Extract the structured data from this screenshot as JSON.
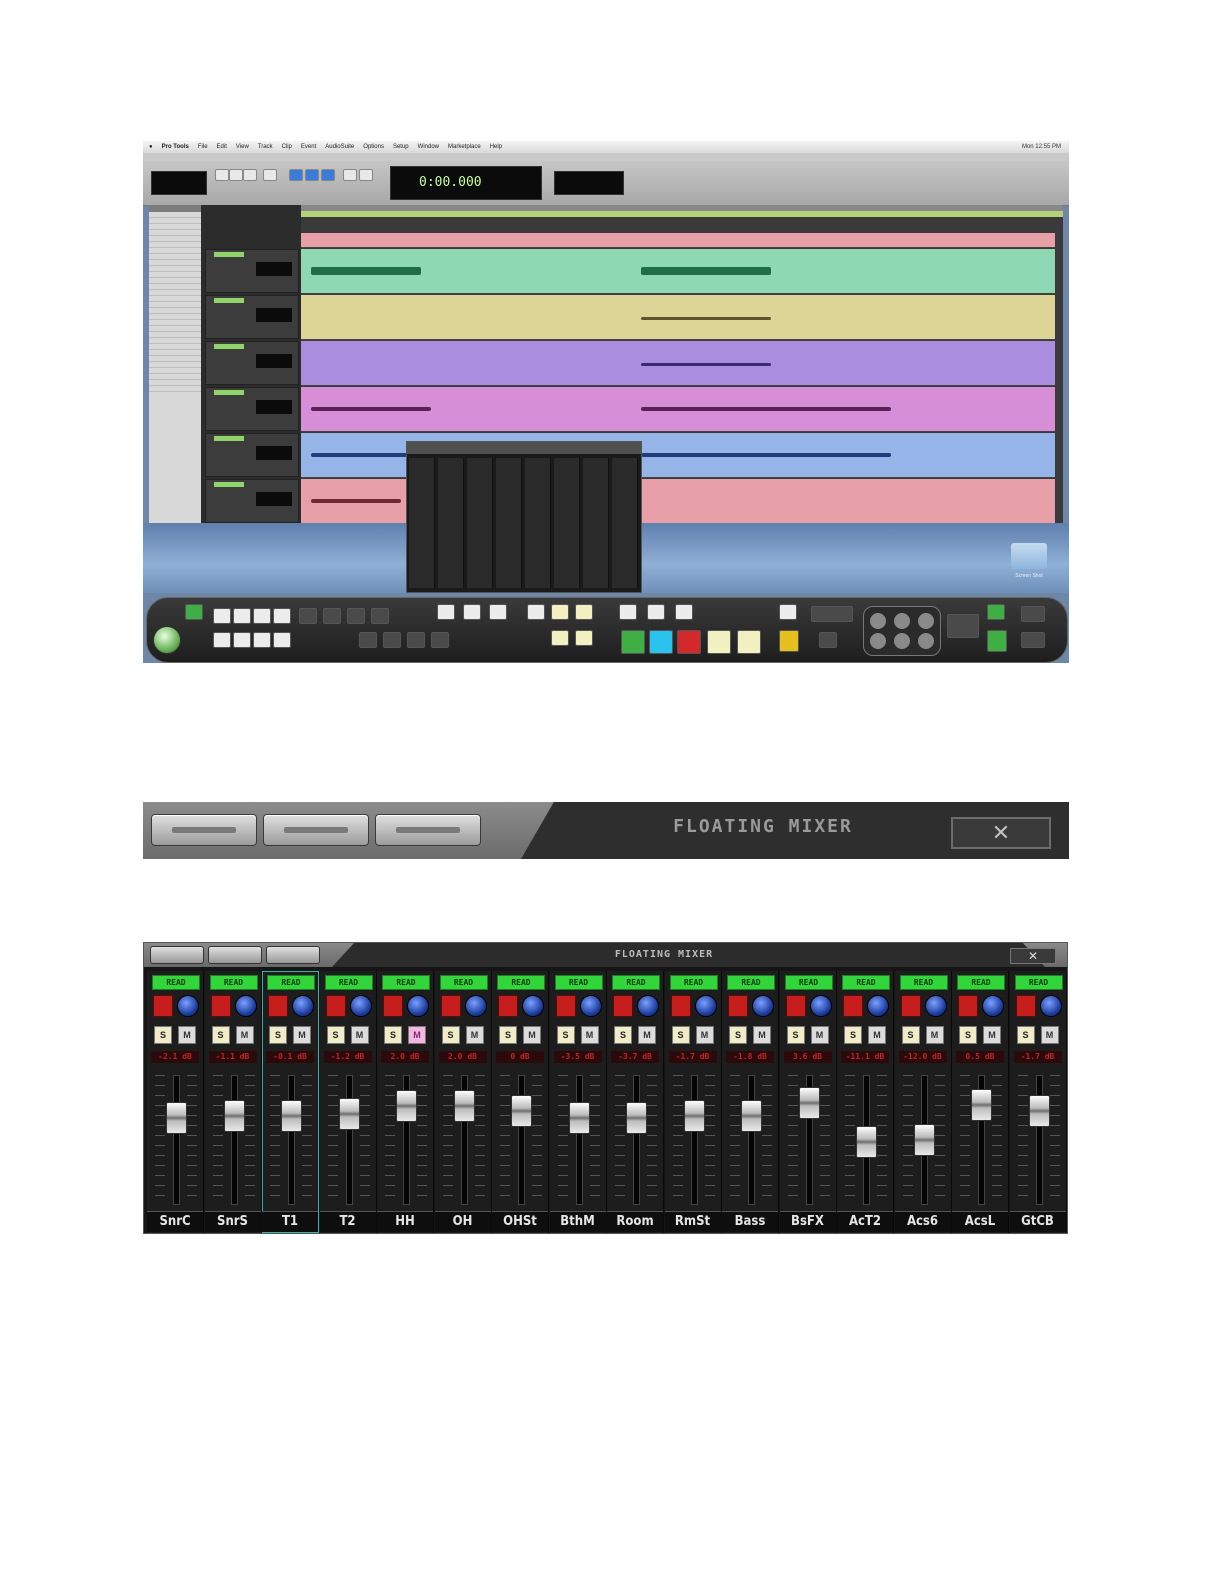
{
  "protools": {
    "app_name": "Pro Tools",
    "menus": [
      "File",
      "Edit",
      "View",
      "Track",
      "Clip",
      "Event",
      "AudioSuite",
      "Options",
      "Setup",
      "Window",
      "Marketplace",
      "Help"
    ],
    "clock": "Mon 12:55 PM",
    "counter": "0:00.000",
    "desktop_folder_label": "Screen Shot"
  },
  "floating_mixer_header": {
    "title": "FLOATING MIXER",
    "close": "✕"
  },
  "floating_mixer": {
    "title": "FLOATING MIXER",
    "close": "✕",
    "channels": [
      {
        "name": "SnrC",
        "auto": "READ",
        "vol": "-2.1 dB",
        "fader": 0.72,
        "mute_on": false,
        "selected": false
      },
      {
        "name": "SnrS",
        "auto": "READ",
        "vol": "-1.1 dB",
        "fader": 0.74,
        "mute_on": false,
        "selected": false
      },
      {
        "name": "T1",
        "auto": "READ",
        "vol": "-0.1 dB",
        "fader": 0.75,
        "mute_on": false,
        "selected": true
      },
      {
        "name": "T2",
        "auto": "READ",
        "vol": "-1.2 dB",
        "fader": 0.77,
        "mute_on": false,
        "selected": false
      },
      {
        "name": "HH",
        "auto": "READ",
        "vol": "2.0 dB",
        "fader": 0.85,
        "mute_on": true,
        "selected": false
      },
      {
        "name": "OH",
        "auto": "READ",
        "vol": "2.0 dB",
        "fader": 0.85,
        "mute_on": false,
        "selected": false
      },
      {
        "name": "OHSt",
        "auto": "READ",
        "vol": "0 dB",
        "fader": 0.8,
        "mute_on": false,
        "selected": false
      },
      {
        "name": "BthM",
        "auto": "READ",
        "vol": "-3.5 dB",
        "fader": 0.72,
        "mute_on": false,
        "selected": false
      },
      {
        "name": "Room",
        "auto": "READ",
        "vol": "-3.7 dB",
        "fader": 0.72,
        "mute_on": false,
        "selected": false
      },
      {
        "name": "RmSt",
        "auto": "READ",
        "vol": "-1.7 dB",
        "fader": 0.75,
        "mute_on": false,
        "selected": false
      },
      {
        "name": "Bass",
        "auto": "READ",
        "vol": "-1.8 dB",
        "fader": 0.75,
        "mute_on": false,
        "selected": false
      },
      {
        "name": "BsFX",
        "auto": "READ",
        "vol": "3.6 dB",
        "fader": 0.88,
        "mute_on": false,
        "selected": false
      },
      {
        "name": "AcT2",
        "auto": "READ",
        "vol": "-11.1 dB",
        "fader": 0.48,
        "mute_on": false,
        "selected": false
      },
      {
        "name": "Acs6",
        "auto": "READ",
        "vol": "-12.0 dB",
        "fader": 0.5,
        "mute_on": false,
        "selected": false
      },
      {
        "name": "AcsL",
        "auto": "READ",
        "vol": "0.5 dB",
        "fader": 0.86,
        "mute_on": false,
        "selected": false
      },
      {
        "name": "GtCB",
        "auto": "READ",
        "vol": "-1.7 dB",
        "fader": 0.8,
        "mute_on": false,
        "selected": false
      }
    ],
    "solo_label": "S",
    "mute_label": "M"
  },
  "colors": {
    "read_green": "#33d63a",
    "record_red": "#c61d1d",
    "pan_blue": "#1a3a9a",
    "volume_red": "#c52222",
    "mute_pink": "#f4b7e4",
    "select_teal": "#3fb0a6"
  }
}
